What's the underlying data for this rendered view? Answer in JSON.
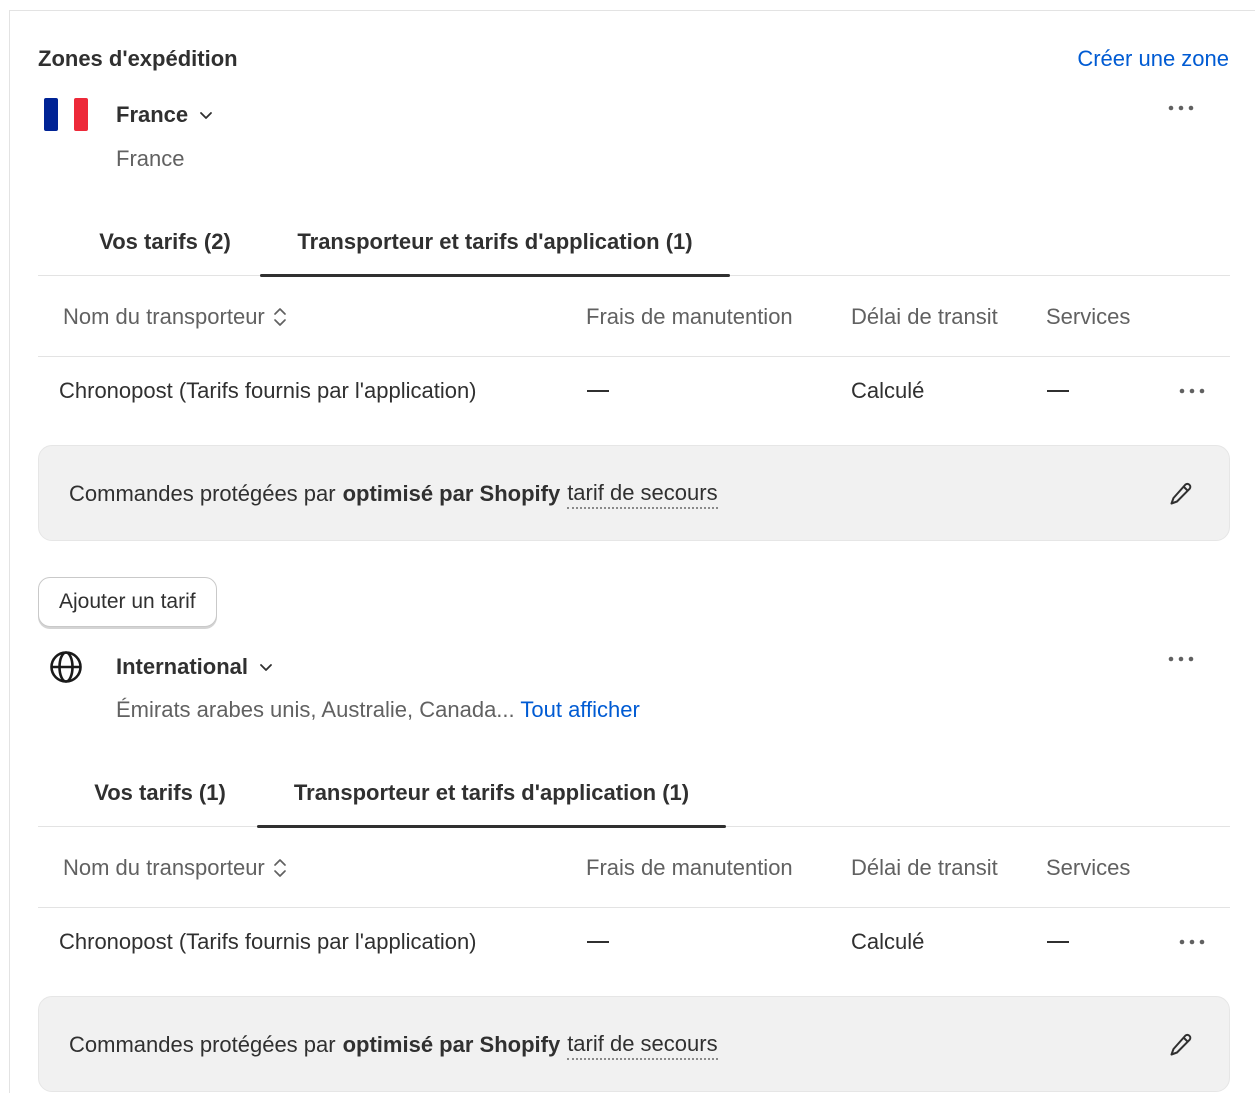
{
  "header": {
    "title": "Zones d'expédition",
    "create_zone": "Créer une zone"
  },
  "zones": [
    {
      "name": "France",
      "subtitle": "France",
      "icon": "france-flag-icon",
      "tabs": [
        {
          "label": "Vos tarifs (2)",
          "active": false
        },
        {
          "label": "Transporteur et tarifs d'application (1)",
          "active": true
        }
      ],
      "columns": [
        "Nom du transporteur",
        "Frais de manutention",
        "Délai de transit",
        "Services"
      ],
      "rows": [
        {
          "carrier": "Chronopost (Tarifs fournis par l'application)",
          "handling": "—",
          "transit": "Calculé",
          "services": "—"
        }
      ],
      "fallback": {
        "prefix": "Commandes protégées par",
        "bold": "optimisé par Shopify",
        "link": "tarif de secours"
      }
    },
    {
      "name": "International",
      "subtitle": "Émirats arabes unis, Australie, Canada...",
      "subtitle_link": "Tout afficher",
      "icon": "globe-icon",
      "tabs": [
        {
          "label": "Vos tarifs (1)",
          "active": false
        },
        {
          "label": "Transporteur et tarifs d'application (1)",
          "active": true
        }
      ],
      "columns": [
        "Nom du transporteur",
        "Frais de manutention",
        "Délai de transit",
        "Services"
      ],
      "rows": [
        {
          "carrier": "Chronopost (Tarifs fournis par l'application)",
          "handling": "—",
          "transit": "Calculé",
          "services": "—"
        }
      ],
      "fallback": {
        "prefix": "Commandes protégées par",
        "bold": "optimisé par Shopify",
        "link": "tarif de secours"
      }
    }
  ],
  "add_rate_label": "Ajouter un tarif",
  "colors": {
    "link": "#005bd3",
    "text": "#303030",
    "muted": "#616161",
    "flag_blue": "#002395",
    "flag_red": "#ed2939"
  }
}
